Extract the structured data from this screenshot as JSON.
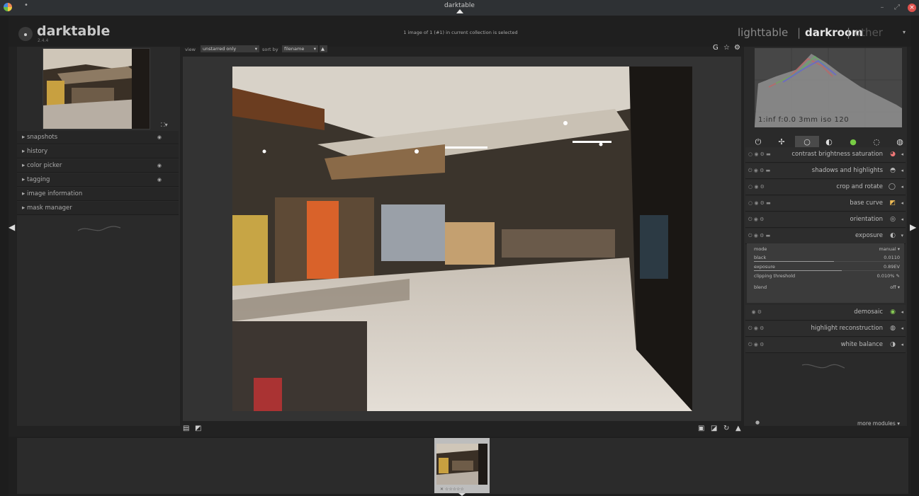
{
  "window": {
    "title": "darktable"
  },
  "header": {
    "app_name": "darktable",
    "version": "2.4.4",
    "collection_info": "1 image of 1 (#1) in current collection is selected",
    "views": [
      "lighttable",
      "darkroom",
      "other"
    ],
    "view_separator": "|",
    "active_view": "darkroom"
  },
  "left_modules": [
    {
      "label": "snapshots",
      "dot": true
    },
    {
      "label": "history",
      "dot": false
    },
    {
      "label": "color picker",
      "dot": true
    },
    {
      "label": "tagging",
      "dot": true
    },
    {
      "label": "image information",
      "dot": false
    },
    {
      "label": "mask manager",
      "dot": false
    }
  ],
  "toolbar": {
    "view_label": "view",
    "view_value": "unstarred only",
    "sort_label": "sort by",
    "sort_value": "filename"
  },
  "histogram": {
    "info": "1:inf f:0.0 3mm iso 120"
  },
  "right_modules": [
    {
      "name": "contrast brightness saturation",
      "icon": "palette-icon"
    },
    {
      "name": "shadows and highlights",
      "icon": "shadows-icon"
    },
    {
      "name": "crop and rotate",
      "icon": "crop-icon"
    },
    {
      "name": "base curve",
      "icon": "curve-icon"
    },
    {
      "name": "orientation",
      "icon": "rotate-icon"
    },
    {
      "name": "exposure",
      "icon": "exposure-icon"
    },
    {
      "name": "demosaic",
      "icon": "demosaic-icon"
    },
    {
      "name": "highlight reconstruction",
      "icon": "highlight-icon"
    },
    {
      "name": "white balance",
      "icon": "wb-icon"
    }
  ],
  "exposure_params": {
    "mode_label": "mode",
    "mode_value": "manual",
    "black_label": "black",
    "black_value": "0.0110",
    "exposure_label": "exposure",
    "exposure_value": "0.89EV",
    "clipping_label": "clipping threshold",
    "clipping_value": "0.010%",
    "blend_label": "blend",
    "blend_value": "off",
    "black_level": 0.55,
    "exposure_level": 0.6
  },
  "more_modules": "more modules",
  "colors": {
    "accent": "#e0524d",
    "panel": "#2a2a2a",
    "background": "#1d1d1d"
  }
}
